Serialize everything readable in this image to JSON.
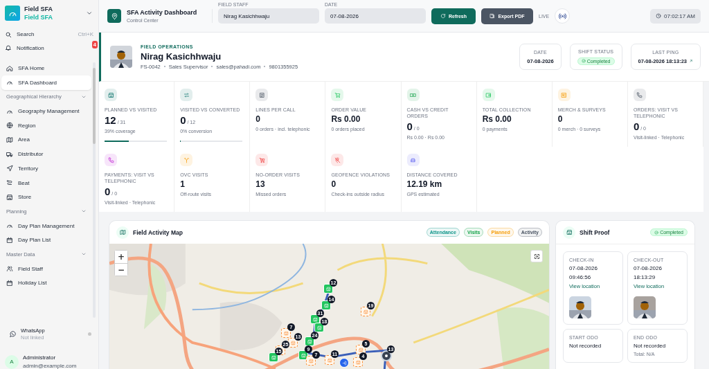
{
  "sidebar": {
    "app_name": "Field SFA",
    "app_subtitle": "Field SFA",
    "search": {
      "label": "Search",
      "shortcut": "Ctrl+K"
    },
    "notification": {
      "label": "Notification",
      "badge": "4"
    },
    "groups": [
      {
        "items": [
          {
            "label": "SFA Home",
            "selected": false
          },
          {
            "label": "SFA Dashboard",
            "selected": true
          }
        ]
      },
      {
        "title": "Geographical Hierarchy",
        "expanded": true,
        "items": [
          {
            "label": "Geography Management",
            "selected": false
          },
          {
            "label": "Region",
            "selected": false
          },
          {
            "label": "Area",
            "selected": false
          },
          {
            "label": "Distributor",
            "selected": false
          },
          {
            "label": "Territory",
            "selected": false
          },
          {
            "label": "Beat",
            "selected": false
          },
          {
            "label": "Store",
            "selected": false
          }
        ]
      },
      {
        "title": "Planning",
        "expanded": true,
        "items": [
          {
            "label": "Day Plan Management",
            "selected": false
          },
          {
            "label": "Day Plan List",
            "selected": false
          }
        ]
      },
      {
        "title": "Master Data",
        "expanded": true,
        "items": [
          {
            "label": "Field Staff",
            "selected": false
          },
          {
            "label": "Holiday List",
            "selected": false
          }
        ]
      }
    ],
    "whatsapp": {
      "label": "WhatsApp",
      "status": "Not linked",
      "color": "#c8c8c8"
    },
    "user": {
      "initial": "A",
      "name": "Administrator",
      "email": "admin@example.com"
    }
  },
  "header": {
    "title": "SFA Activity Dashboard",
    "subtitle": "Control Center",
    "field_staff": {
      "label": "FIELD STAFF",
      "value": "Nirag Kasichhwaju"
    },
    "date": {
      "label": "DATE",
      "value": "07-08-2026"
    },
    "refresh": "Refresh",
    "export": "Export PDF",
    "live": "LIVE",
    "clock": "07:02:17 AM"
  },
  "profile": {
    "section": "FIELD OPERATIONS",
    "name": "Nirag Kasichhwaju",
    "details": [
      "FS-0042",
      "Sales Supervisor",
      "sales@pahadi.com",
      "9801355925"
    ],
    "stats": [
      {
        "label": "DATE",
        "value": "07-08-2026",
        "kind": "text"
      },
      {
        "label": "SHIFT STATUS",
        "value": "Completed",
        "kind": "badge"
      },
      {
        "label": "LAST PING",
        "value": "07-08-2026 18:13:23",
        "kind": "link"
      }
    ]
  },
  "metrics": [
    {
      "label": "PLANNED VS VISITED",
      "value": "12",
      "total": "/ 31",
      "sub": "39% coverage",
      "level": 0.39
    },
    {
      "label": "VISITED VS CONVERTED",
      "value": "0",
      "total": "/ 12",
      "sub": "0% conversion",
      "level": 0
    },
    {
      "label": "LINES PER CALL",
      "value": "0",
      "sub": "0 orders · incl. telephonic"
    },
    {
      "label": "ORDER VALUE",
      "value": "Rs 0.00",
      "sub": "0 orders placed"
    },
    {
      "label": "CASH VS CREDIT ORDERS",
      "value": "0",
      "total": "/ 0",
      "sub": "Rs 0.00 · Rs 0.00"
    },
    {
      "label": "TOTAL COLLECTION",
      "value": "Rs 0.00",
      "sub": "0 payments"
    },
    {
      "label": "MERCH & SURVEYS",
      "value": "0",
      "sub": "0 merch · 0 surveys"
    },
    {
      "label": "ORDERS: VISIT VS TELEPHONIC",
      "value": "0",
      "total": "/ 0",
      "sub": "Visit-linked · Telephonic"
    },
    {
      "label": "PAYMENTS: VISIT VS TELEPHONIC",
      "value": "0",
      "total": "/ 0",
      "sub": "Visit-linked · Telephonic"
    },
    {
      "label": "OVC VISITS",
      "value": "1",
      "sub": "Off-route visits"
    },
    {
      "label": "NO-ORDER VISITS",
      "value": "13",
      "sub": "Missed orders"
    },
    {
      "label": "GEOFENCE VIOLATIONS",
      "value": "0",
      "sub": "Check-ins outside radius"
    },
    {
      "label": "DISTANCE COVERED",
      "value": "12.19 km",
      "sub": "GPS estimated"
    }
  ],
  "map": {
    "title": "Field Activity Map",
    "legend": [
      {
        "label": "Attendance"
      },
      {
        "label": "Visits"
      },
      {
        "label": "Planned"
      },
      {
        "label": "Activity"
      }
    ],
    "zoom_in": "+",
    "zoom_out": "−",
    "markers": [
      {
        "kind": "visit",
        "label": "12"
      },
      {
        "kind": "visit",
        "label": "14"
      },
      {
        "kind": "visit",
        "label": "31"
      },
      {
        "kind": "visit",
        "label": "18"
      },
      {
        "kind": "visit",
        "label": "24"
      },
      {
        "kind": "planned",
        "label": "19"
      },
      {
        "kind": "planned",
        "label": "7"
      },
      {
        "kind": "planned",
        "label": "13"
      },
      {
        "kind": "planned",
        "label": "25"
      },
      {
        "kind": "visit",
        "label": "15"
      },
      {
        "kind": "visit",
        "label": "9"
      },
      {
        "kind": "planned",
        "label": "7"
      },
      {
        "kind": "planned",
        "label": "11"
      },
      {
        "kind": "planned",
        "label": "5"
      },
      {
        "kind": "planned",
        "label": "4"
      },
      {
        "kind": "activity",
        "label": "13"
      },
      {
        "kind": "attendance"
      }
    ]
  },
  "shift_proof": {
    "title": "Shift Proof",
    "status": "Completed",
    "checks": [
      {
        "label": "CHECK-IN",
        "date": "07-08-2026",
        "time": "09:46:56",
        "link": "View location"
      },
      {
        "label": "CHECK-OUT",
        "date": "07-08-2026",
        "time": "18:13:29",
        "link": "View location"
      }
    ],
    "odo": [
      {
        "label": "START ODO",
        "value": "Not recorded"
      },
      {
        "label": "END ODO",
        "value": "Not recorded",
        "note": "Total: N/A"
      }
    ]
  }
}
